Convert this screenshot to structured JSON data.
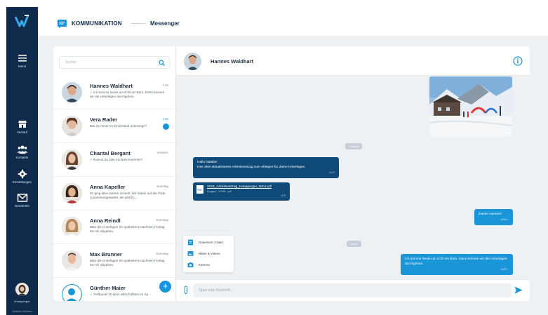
{
  "colors": {
    "rail": "#0f2a4a",
    "accent": "#1a95d8",
    "incoming_bubble": "#0f4a78",
    "background": "#eef1f4"
  },
  "rail": {
    "items": [
      {
        "label": "Menü",
        "icon": "menu-icon"
      },
      {
        "label": "Verkauf",
        "icon": "store-icon"
      },
      {
        "label": "Kontakte",
        "icon": "contacts-icon"
      },
      {
        "label": "Einstellungen",
        "icon": "gear-icon"
      },
      {
        "label": "Newsletter",
        "icon": "mail-icon"
      }
    ],
    "user": "nhoepperger",
    "company": "Westfirst Software"
  },
  "header": {
    "title": "KOMMUNIKATION",
    "subtitle": "Messenger"
  },
  "search": {
    "placeholder": "Suche"
  },
  "contacts": [
    {
      "name": "Hannes Waldhart",
      "time": "7:46",
      "preview": "✓ Ich komme heute um 8:30 ins Büro. Dann können wir die Unterlagen durchgehen."
    },
    {
      "name": "Vera Rader",
      "time": "7:32",
      "preview": "Bist du heute im Kinderland unterwegs?",
      "unread": true
    },
    {
      "name": "Chantal Bergant",
      "time": "Gestern",
      "preview": "✓ Kannst du bitte ins Büro kommen?"
    },
    {
      "name": "Anna Kapeller",
      "time": "Sonntag",
      "preview": "Es ging alles extrem schnell. Wir haben auf der Piste zusammengewartet, als plötzlic..."
    },
    {
      "name": "Anna Reindl",
      "time": "Samstag",
      "preview": "Bitte die Unterlagen bis spätestens nächsten Freitag bei mir abgeben."
    },
    {
      "name": "Max Brunner",
      "time": "Samstag",
      "preview": "Bitte die Unterlagen bis spätestens nächsten Freitag bei mir abgeben."
    },
    {
      "name": "Günther Maier",
      "time": "25.2.",
      "preview": "✓ Treffpunkt ist beim Skischulbüro im Sp..."
    }
  ],
  "chat": {
    "name": "Hannes Waldhart",
    "photo_time": "9:31",
    "day_yesterday": "Gestern",
    "msg1": {
      "line1": "Hallo Natalie!",
      "line2": "Hier dein aktualisiertes Arbeitsvertrag zum Ablegen für deine Unterlagen.",
      "time": "14:37"
    },
    "file": {
      "name": "2024_Arbeitsvertrag_Hoepperger_NEU.pdf",
      "meta": "8 pages · 14 MB · pdf",
      "time": "14:37"
    },
    "msg_out1": {
      "text": "Danke Hannes!",
      "time": "14:59 ✓"
    },
    "day_today": "Heute",
    "attach": [
      {
        "label": "Dokument / Datei",
        "icon": "document-icon"
      },
      {
        "label": "Bilder & Videos",
        "icon": "image-icon"
      },
      {
        "label": "Kamera",
        "icon": "camera-icon"
      }
    ],
    "msg_out2": {
      "text": "Ich komme heute um 8:30 ins Büro. Dann können wir die Unterlagen durchgehen.",
      "time": "14:59 ✓"
    },
    "composer_placeholder": "Tippe eine Nachricht..."
  }
}
